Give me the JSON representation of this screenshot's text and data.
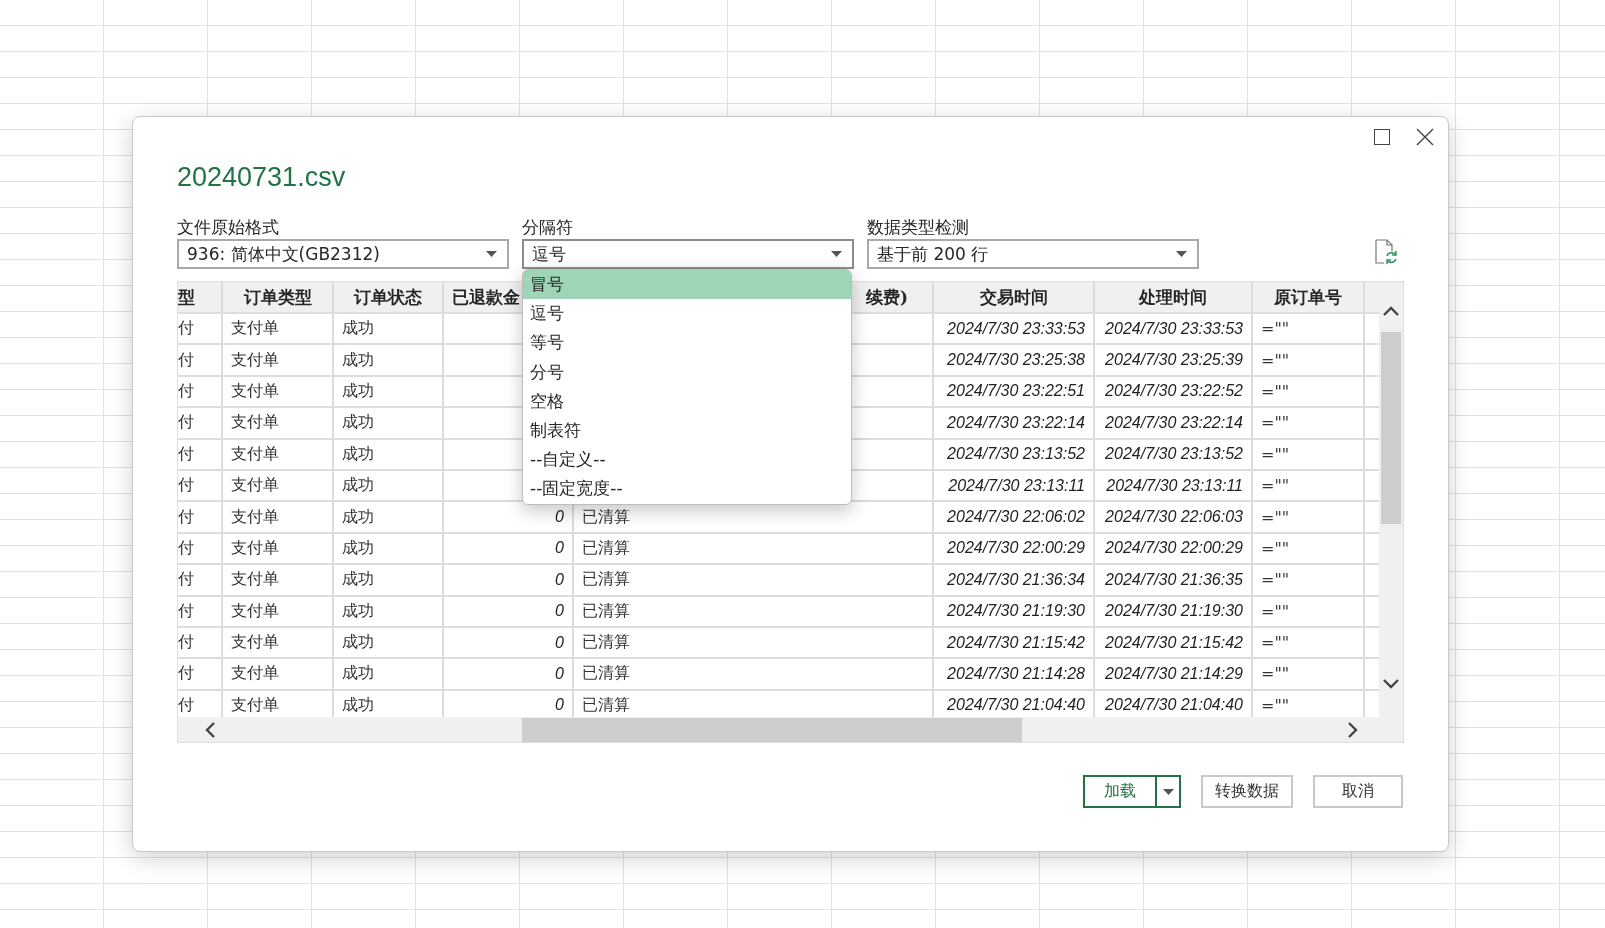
{
  "dialog": {
    "title": "20240731.csv"
  },
  "fields": [
    {
      "label": "文件原始格式",
      "value": "936: 简体中文(GB2312)",
      "expanded": false
    },
    {
      "label": "分隔符",
      "value": "逗号",
      "expanded": true
    },
    {
      "label": "数据类型检测",
      "value": "基于前 200 行",
      "expanded": false
    }
  ],
  "dropdown": {
    "options": [
      {
        "label": "冒号",
        "selected": true
      },
      {
        "label": "逗号",
        "selected": false
      },
      {
        "label": "等号",
        "selected": false
      },
      {
        "label": "分号",
        "selected": false
      },
      {
        "label": "空格",
        "selected": false
      },
      {
        "label": "制表符",
        "selected": false
      },
      {
        "label": "--自定义--",
        "selected": false
      },
      {
        "label": "--固定宽度--",
        "selected": false
      }
    ]
  },
  "table": {
    "columns": [
      "型",
      "订单类型",
      "订单状态",
      "已退款金",
      "续费)",
      "交易时间",
      "处理时间",
      "原订单号"
    ],
    "rows": [
      {
        "cells_left": [
          "付",
          "支付单",
          "成功"
        ],
        "cells_right": [
          "2024/7/30 23:33:53",
          "2024/7/30 23:33:53",
          "=\"\""
        ]
      },
      {
        "cells_left": [
          "付",
          "支付单",
          "成功"
        ],
        "cells_right": [
          "2024/7/30 23:25:38",
          "2024/7/30 23:25:39",
          "=\"\""
        ]
      },
      {
        "cells_left": [
          "付",
          "支付单",
          "成功"
        ],
        "cells_right": [
          "2024/7/30 23:22:51",
          "2024/7/30 23:22:52",
          "=\"\""
        ]
      },
      {
        "cells_left": [
          "付",
          "支付单",
          "成功"
        ],
        "cells_right": [
          "2024/7/30 23:22:14",
          "2024/7/30 23:22:14",
          "=\"\""
        ]
      },
      {
        "cells_left": [
          "付",
          "支付单",
          "成功"
        ],
        "cells_right": [
          "2024/7/30 23:13:52",
          "2024/7/30 23:13:52",
          "=\"\""
        ]
      },
      {
        "cells_left": [
          "付",
          "支付单",
          "成功"
        ],
        "cells_right": [
          "2024/7/30 23:13:11",
          "2024/7/30 23:13:11",
          "=\"\""
        ]
      },
      {
        "cells_left": [
          "付",
          "支付单",
          "成功"
        ],
        "column_4": "0",
        "column_5": "已清算",
        "cells_right": [
          "2024/7/30 22:06:02",
          "2024/7/30 22:06:03",
          "=\"\""
        ]
      },
      {
        "cells_left": [
          "付",
          "支付单",
          "成功"
        ],
        "column_4": "0",
        "column_5": "已清算",
        "cells_right": [
          "2024/7/30 22:00:29",
          "2024/7/30 22:00:29",
          "=\"\""
        ]
      },
      {
        "cells_left": [
          "付",
          "支付单",
          "成功"
        ],
        "column_4": "0",
        "column_5": "已清算",
        "cells_right": [
          "2024/7/30 21:36:34",
          "2024/7/30 21:36:35",
          "=\"\""
        ]
      },
      {
        "cells_left": [
          "付",
          "支付单",
          "成功"
        ],
        "column_4": "0",
        "column_5": "已清算",
        "cells_right": [
          "2024/7/30 21:19:30",
          "2024/7/30 21:19:30",
          "=\"\""
        ]
      },
      {
        "cells_left": [
          "付",
          "支付单",
          "成功"
        ],
        "column_4": "0",
        "column_5": "已清算",
        "cells_right": [
          "2024/7/30 21:15:42",
          "2024/7/30 21:15:42",
          "=\"\""
        ]
      },
      {
        "cells_left": [
          "付",
          "支付单",
          "成功"
        ],
        "column_4": "0",
        "column_5": "已清算",
        "cells_right": [
          "2024/7/30 21:14:28",
          "2024/7/30 21:14:29",
          "=\"\""
        ]
      },
      {
        "cells_left": [
          "付",
          "支付单",
          "成功"
        ],
        "column_4": "0",
        "column_5": "已清算",
        "cells_right": [
          "2024/7/30 21:04:40",
          "2024/7/30 21:04:40",
          "=\"\""
        ]
      }
    ]
  },
  "buttons": [
    {
      "label": "加载",
      "kind": "split",
      "primary": true
    },
    {
      "label": "转换数据",
      "kind": "plain",
      "primary": false
    },
    {
      "label": "取消",
      "kind": "plain",
      "primary": false
    }
  ]
}
